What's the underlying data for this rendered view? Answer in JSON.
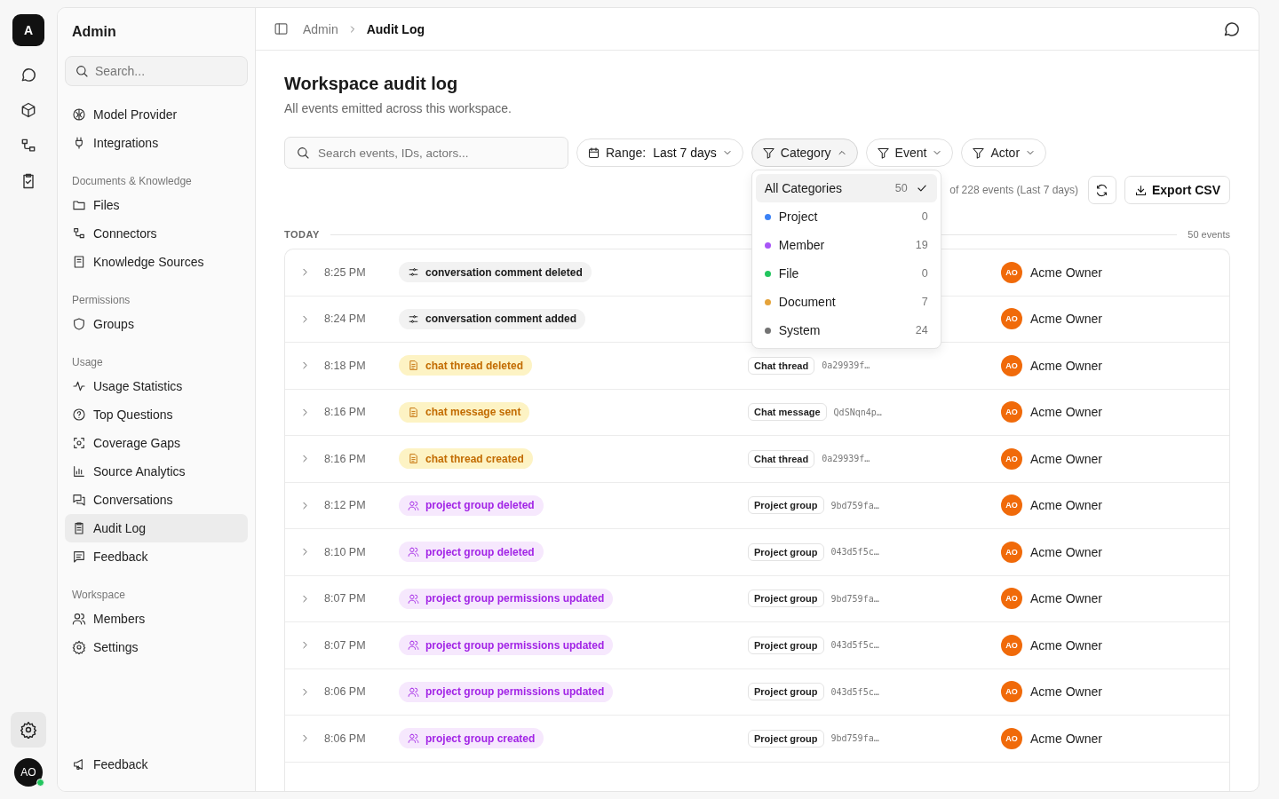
{
  "rail": {
    "logo": "A",
    "avatar": "AO",
    "online": true,
    "settings_selected": true
  },
  "sidebar": {
    "title": "Admin",
    "search": {
      "placeholder": "Search..."
    },
    "footer": "Feedback",
    "sections": [
      {
        "items": [
          {
            "label": "Model Provider",
            "selected": false
          },
          {
            "label": "Integrations",
            "selected": false
          }
        ]
      },
      {
        "heading": "Documents & Knowledge",
        "items": [
          {
            "label": "Files",
            "selected": false
          },
          {
            "label": "Connectors",
            "selected": false
          },
          {
            "label": "Knowledge Sources",
            "selected": false
          }
        ]
      },
      {
        "heading": "Permissions",
        "items": [
          {
            "label": "Groups",
            "selected": false
          }
        ]
      },
      {
        "heading": "Usage",
        "items": [
          {
            "label": "Usage Statistics",
            "selected": false
          },
          {
            "label": "Top Questions",
            "selected": false
          },
          {
            "label": "Coverage Gaps",
            "selected": false
          },
          {
            "label": "Source Analytics",
            "selected": false
          },
          {
            "label": "Conversations",
            "selected": false
          },
          {
            "label": "Audit Log",
            "selected": true
          },
          {
            "label": "Feedback",
            "selected": false
          }
        ]
      },
      {
        "heading": "Workspace",
        "items": [
          {
            "label": "Members",
            "selected": false
          },
          {
            "label": "Settings",
            "selected": false
          }
        ]
      }
    ]
  },
  "breadcrumb": [
    "Admin",
    "Audit Log"
  ],
  "page": {
    "title": "Workspace audit log",
    "subtitle": "All events emitted across this workspace."
  },
  "filters": {
    "search": {
      "placeholder": "Search events, IDs, actors..."
    },
    "range": {
      "label": "Range:",
      "value": "Last 7 days"
    },
    "menus": [
      {
        "label": "Category",
        "expanded": true
      },
      {
        "label": "Event",
        "expanded": false
      },
      {
        "label": "Actor",
        "expanded": false
      }
    ],
    "options": [
      {
        "label": "All Categories",
        "count": "50",
        "selected": true
      },
      {
        "label": "Project",
        "count": "0",
        "color": "#3b82f6",
        "selected": false
      },
      {
        "label": "Member",
        "count": "19",
        "color": "#a855f7",
        "selected": false
      },
      {
        "label": "File",
        "count": "0",
        "color": "#22c55e",
        "selected": false
      },
      {
        "label": "Document",
        "count": "7",
        "color": "#e5a33a",
        "selected": false
      },
      {
        "label": "System",
        "count": "24",
        "color": "#737373",
        "selected": false
      }
    ]
  },
  "summary": "of 228 events (Last 7 days)",
  "export": "Export CSV",
  "group": {
    "label": "TODAY",
    "count": "50 events"
  },
  "rows": [
    {
      "time": "8:25 PM",
      "event": "conversation comment deleted",
      "kind": "system",
      "actor": "Acme Owner",
      "initials": "AO"
    },
    {
      "time": "8:24 PM",
      "event": "conversation comment added",
      "kind": "system",
      "actor": "Acme Owner",
      "initials": "AO"
    },
    {
      "time": "8:18 PM",
      "event": "chat thread deleted",
      "kind": "document",
      "target": "Chat thread",
      "target_id": "0a29939f…",
      "actor": "Acme Owner",
      "initials": "AO"
    },
    {
      "time": "8:16 PM",
      "event": "chat message sent",
      "kind": "document",
      "target": "Chat message",
      "target_id": "QdSNqn4p…",
      "actor": "Acme Owner",
      "initials": "AO"
    },
    {
      "time": "8:16 PM",
      "event": "chat thread created",
      "kind": "document",
      "target": "Chat thread",
      "target_id": "0a29939f…",
      "actor": "Acme Owner",
      "initials": "AO"
    },
    {
      "time": "8:12 PM",
      "event": "project group deleted",
      "kind": "member",
      "target": "Project group",
      "target_id": "9bd759fa…",
      "actor": "Acme Owner",
      "initials": "AO"
    },
    {
      "time": "8:10 PM",
      "event": "project group deleted",
      "kind": "member",
      "target": "Project group",
      "target_id": "043d5f5c…",
      "actor": "Acme Owner",
      "initials": "AO"
    },
    {
      "time": "8:07 PM",
      "event": "project group permissions updated",
      "kind": "member",
      "target": "Project group",
      "target_id": "9bd759fa…",
      "actor": "Acme Owner",
      "initials": "AO"
    },
    {
      "time": "8:07 PM",
      "event": "project group permissions updated",
      "kind": "member",
      "target": "Project group",
      "target_id": "043d5f5c…",
      "actor": "Acme Owner",
      "initials": "AO"
    },
    {
      "time": "8:06 PM",
      "event": "project group permissions updated",
      "kind": "member",
      "target": "Project group",
      "target_id": "043d5f5c…",
      "actor": "Acme Owner",
      "initials": "AO"
    },
    {
      "time": "8:06 PM",
      "event": "project group created",
      "kind": "member",
      "target": "Project group",
      "target_id": "9bd759fa…",
      "actor": "Acme Owner",
      "initials": "AO"
    }
  ]
}
